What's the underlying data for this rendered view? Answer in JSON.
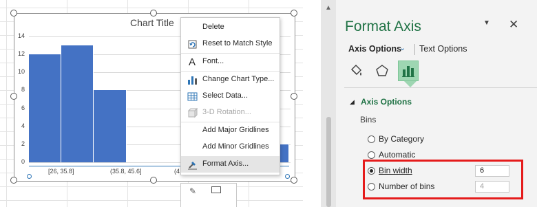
{
  "chart": {
    "title": "Chart Title",
    "y_ticks": [
      "14",
      "12",
      "10",
      "8",
      "6",
      "4",
      "2",
      "0"
    ],
    "x_labels": [
      "[26, 35.8]",
      "(35.8, 45.6]",
      "(4"
    ],
    "bar_color": "#4472c4"
  },
  "chart_data": {
    "type": "bar",
    "title": "Chart Title",
    "categories": [
      "[26, 35.8]",
      "(35.8, 45.6]",
      "",
      "",
      "",
      "",
      "",
      ""
    ],
    "values": [
      12,
      13,
      8,
      null,
      null,
      null,
      null,
      2
    ],
    "ylim": [
      0,
      14
    ],
    "xlabel": "",
    "ylabel": "",
    "grid": true
  },
  "context_menu": {
    "items": [
      {
        "label": "Delete",
        "icon": "none"
      },
      {
        "label": "Reset to Match Style",
        "icon": "reset-style-icon"
      },
      {
        "label": "Font...",
        "icon": "font-icon"
      },
      {
        "label": "Change Chart Type...",
        "icon": "chart-type-icon"
      },
      {
        "label": "Select Data...",
        "icon": "select-data-icon"
      },
      {
        "label": "3-D Rotation...",
        "icon": "rotation-3d-icon",
        "disabled": true
      },
      {
        "label": "Add Major Gridlines",
        "icon": "none"
      },
      {
        "label": "Add Minor Gridlines",
        "icon": "none"
      },
      {
        "label": "Format Axis...",
        "icon": "format-axis-icon",
        "hovered": true
      }
    ]
  },
  "pane": {
    "title": "Format Axis",
    "tab_axis_options": "Axis Options",
    "tab_text_options": "Text Options",
    "section_title": "Axis Options",
    "bins_label": "Bins",
    "radios": [
      {
        "label": "By Category",
        "checked": false
      },
      {
        "label": "Automatic",
        "checked": false
      },
      {
        "label": "Bin width",
        "checked": true
      },
      {
        "label": "Number of bins",
        "checked": false
      }
    ],
    "bin_width_value": "6",
    "number_of_bins_value": "4",
    "accent_color": "#217346",
    "highlight_color": "#e51b1b"
  }
}
